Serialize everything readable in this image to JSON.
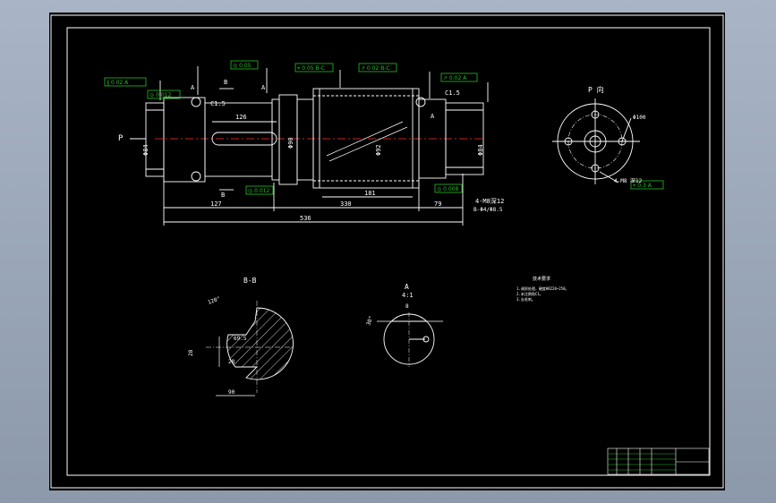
{
  "colors": {
    "paper": "#000000",
    "line": "#ffffff",
    "tolerance_frame": "#22c022",
    "window_bg": "#9aa6b8",
    "center_line": "#ff3030"
  },
  "view_labels": {
    "b_section": "B-B",
    "p_view": "P 向",
    "a_detail_letter": "A",
    "a_detail_scale": "4:1",
    "p_arrow": "P",
    "arrow_a_left": "A",
    "arrow_a_mid": "A",
    "arrow_a_right": "A",
    "arrow_b_top": "B",
    "arrow_b_bot": "B"
  },
  "tolerances": {
    "t1": "∥ 0.02 A",
    "t2": "◎ 0.012",
    "t3": "◎ 0.05",
    "t4": "◎ 0.012",
    "t5": "⌖ 0.05 B-C",
    "t6": "↗ 0.02 B-C",
    "t7": "↗ 0.02 A",
    "t8": "◎ 0.008",
    "t9": "⌖ 0.3 A"
  },
  "main_view": {
    "dim_length_total": "536",
    "dim_left": "127",
    "dim_mid": "330",
    "dim_right": "79",
    "dim_keyway": "126",
    "dim_thread": "181",
    "chamfer_left": "C1.5",
    "chamfer_right": "C1.5",
    "dia_left": "Φ84",
    "dia_right": "Φ84",
    "dia_mid": "Φ92",
    "dia_shoulder": "Φ90",
    "thread_note": "4-M8深12",
    "bolt_note": "4-M8 深12",
    "center_note": "B-Φ4/Φ8.5"
  },
  "p_view": {
    "pcd": "Φ100"
  },
  "b_section": {
    "angle": "120°",
    "dim_flat": "69.5",
    "dim_width": "28",
    "dim_height": "28",
    "dim_keyway": "90"
  },
  "a_detail": {
    "dim_width": "8",
    "angle": "30°"
  },
  "tech_req": {
    "title": "技术要求",
    "lines": [
      "1.调质处理，硬度HB220~250。",
      "2.未注倒角C1。",
      "3.去毛刺。"
    ]
  },
  "title_block": {
    "cols": 6,
    "rows": 5
  }
}
